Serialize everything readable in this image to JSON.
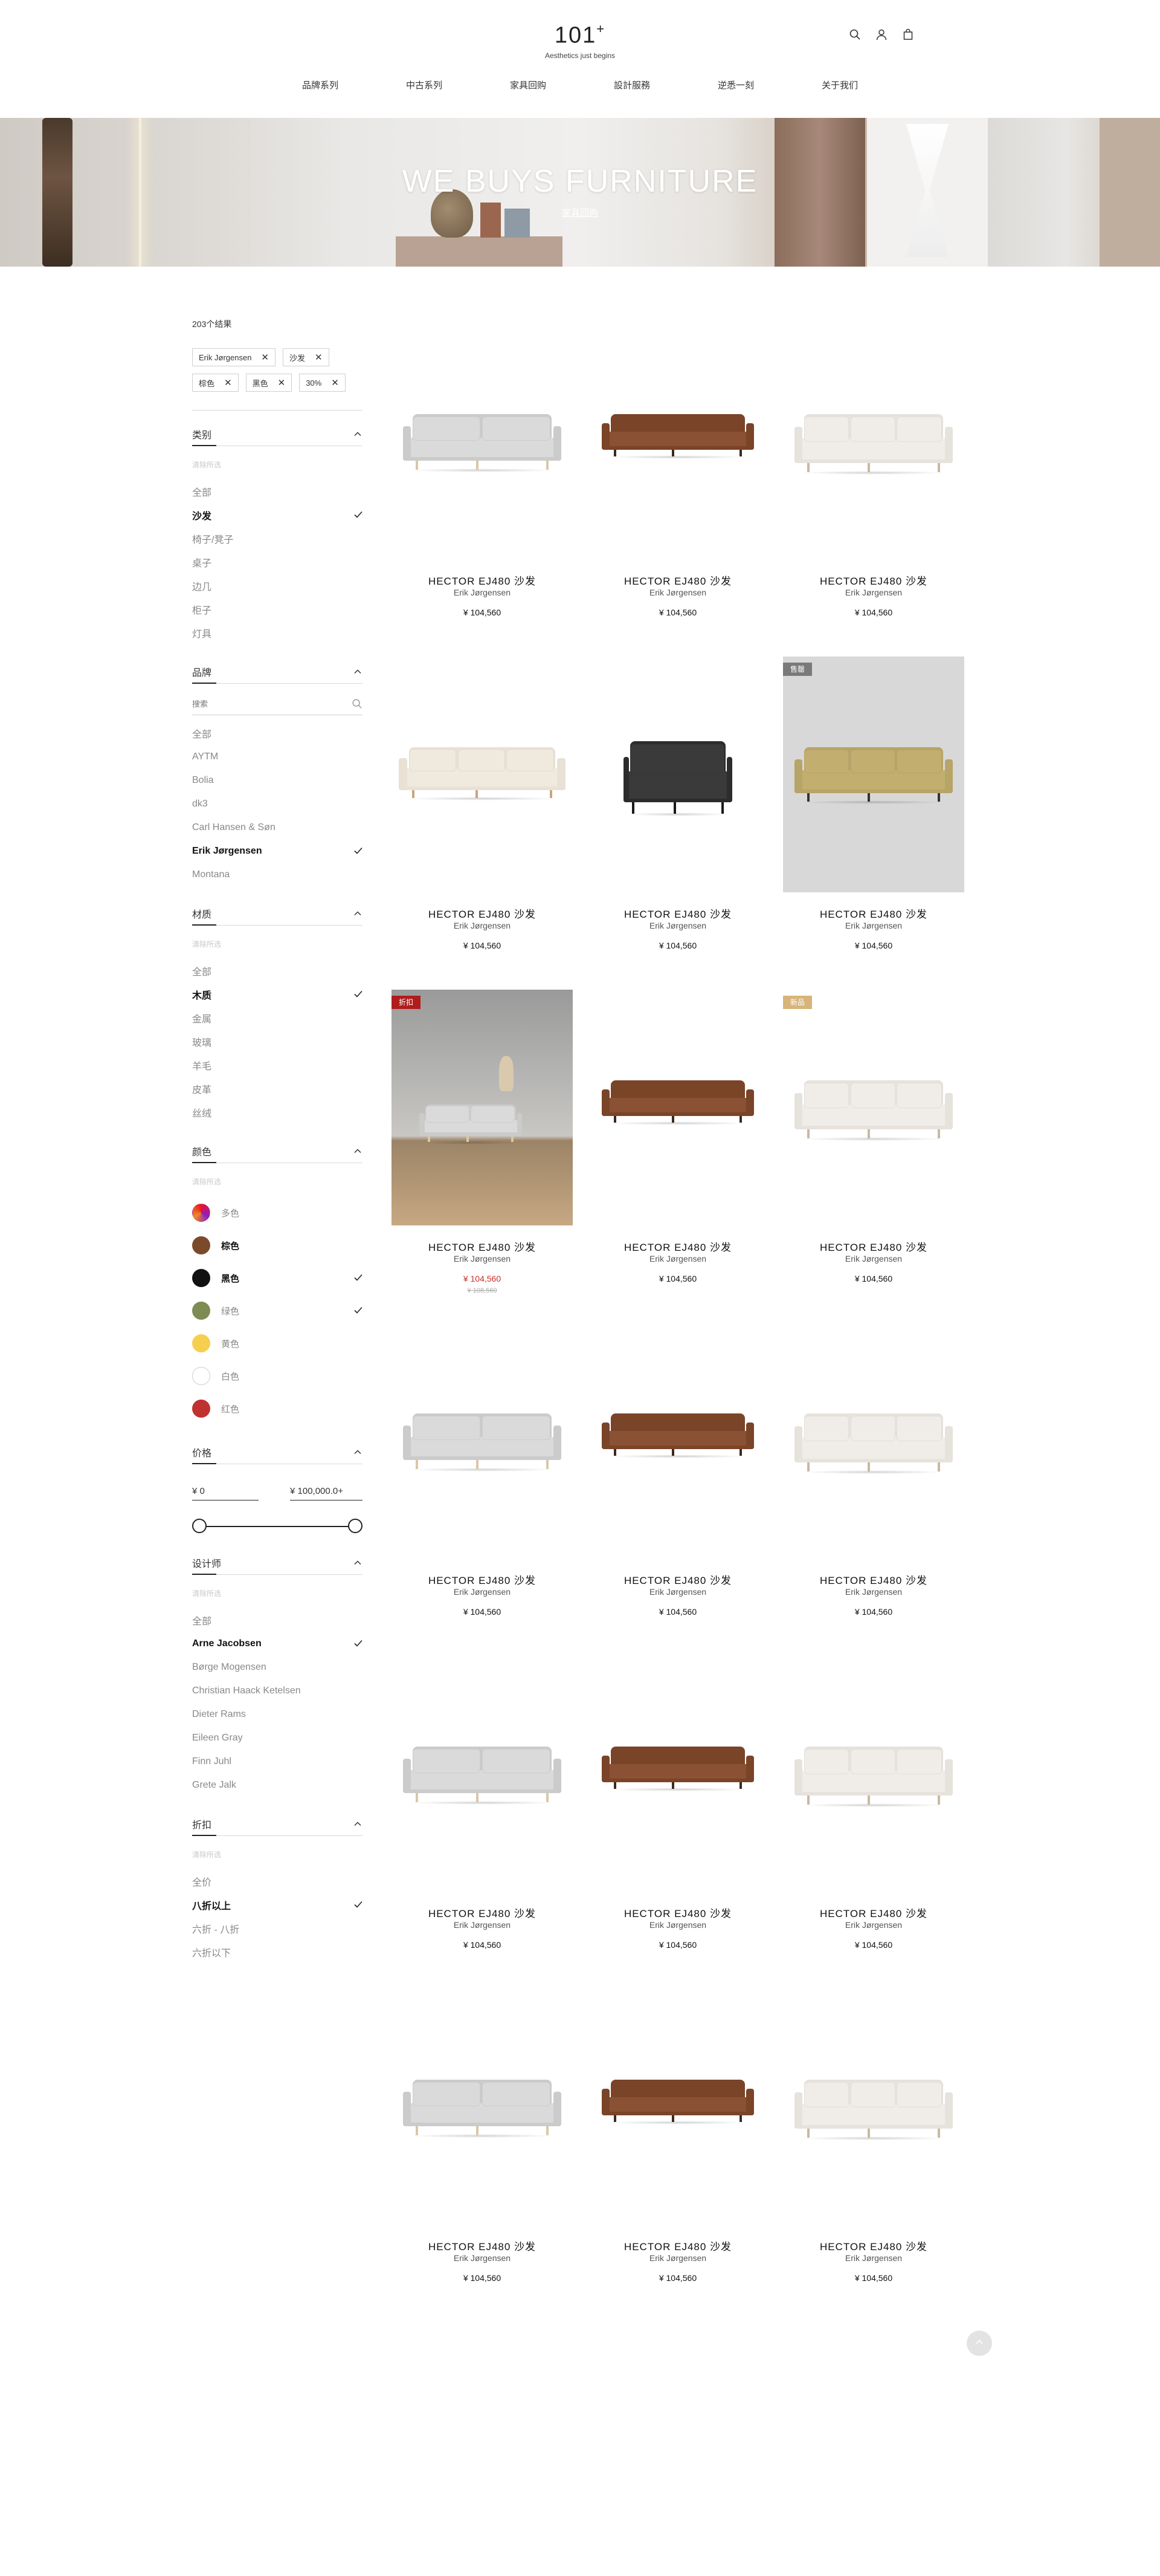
{
  "header": {
    "logo": "101",
    "logo_sup": "+",
    "tagline": "Aesthetics just begins",
    "icons": [
      "search-icon",
      "user-icon",
      "bag-icon"
    ]
  },
  "nav": [
    "品牌系列",
    "中古系列",
    "家具回购",
    "設計服務",
    "逆悉一刻",
    "关于我们"
  ],
  "hero": {
    "title": "WE BUYS FURNITURE",
    "link": "家具回购"
  },
  "sidebar": {
    "result_count": "203个结果",
    "chips": [
      "Erik Jørgensen",
      "沙发",
      "棕色",
      "黑色",
      "30%"
    ],
    "category": {
      "title": "类别",
      "clear": "清除所选",
      "options": [
        "全部",
        "沙发",
        "椅子/凳子",
        "桌子",
        "边几",
        "柜子",
        "灯具"
      ],
      "active": [
        1
      ]
    },
    "brand": {
      "title": "品牌",
      "search_placeholder": "搜索",
      "options": [
        "全部",
        "AYTM",
        "Bolia",
        "dk3",
        "Carl Hansen & Søn",
        "Erik Jørgensen",
        "Montana"
      ],
      "active": [
        5
      ]
    },
    "material": {
      "title": "材质",
      "clear": "清除所选",
      "options": [
        "全部",
        "木质",
        "金属",
        "玻璃",
        "羊毛",
        "皮革",
        "丝绒"
      ],
      "active": [
        1
      ]
    },
    "color": {
      "title": "颜色",
      "clear": "清除所选",
      "options": [
        {
          "label": "多色",
          "color": "multi"
        },
        {
          "label": "棕色",
          "color": "#7a4a2a"
        },
        {
          "label": "黑色",
          "color": "#111111"
        },
        {
          "label": "绿色",
          "color": "#7d8c52"
        },
        {
          "label": "黄色",
          "color": "#f5cf50"
        },
        {
          "label": "白色",
          "color": "#ffffff"
        },
        {
          "label": "红色",
          "color": "#c0322f"
        }
      ],
      "checked": [
        2,
        3
      ],
      "bold": [
        1,
        2
      ]
    },
    "price": {
      "title": "价格",
      "min": "¥ 0",
      "max": "¥ 100,000.0+"
    },
    "designer": {
      "title": "设计师",
      "clear": "清除所选",
      "options": [
        "全部",
        "Arne Jacobsen",
        "Børge Mogensen",
        "Christian Haack Ketelsen",
        "Dieter Rams",
        "Eileen Gray",
        "Finn Juhl",
        "Grete Jalk"
      ],
      "active": [
        1
      ]
    },
    "discount": {
      "title": "折扣",
      "clear": "清除所选",
      "options": [
        "全价",
        "八折以上",
        "六折 - 八折",
        "六折以下"
      ],
      "active": [
        1
      ]
    }
  },
  "products": [
    {
      "name": "HECTOR EJ480 沙发",
      "designer": "Erik Jørgensen",
      "price": "¥ 104,560",
      "style": "grey"
    },
    {
      "name": "HECTOR EJ480 沙发",
      "designer": "Erik Jørgensen",
      "price": "¥ 104,560",
      "style": "brown"
    },
    {
      "name": "HECTOR EJ480 沙发",
      "designer": "Erik Jørgensen",
      "price": "¥ 104,560",
      "style": "white"
    },
    {
      "name": "HECTOR EJ480 沙发",
      "designer": "Erik Jørgensen",
      "price": "¥ 104,560",
      "style": "cream"
    },
    {
      "name": "HECTOR EJ480 沙发",
      "designer": "Erik Jørgensen",
      "price": "¥ 104,560",
      "style": "black-chair"
    },
    {
      "name": "HECTOR EJ480 沙发",
      "designer": "Erik Jørgensen",
      "price": "¥ 104,560",
      "style": "olive",
      "badge": "售罄",
      "badge_color": "#7a7a7a"
    },
    {
      "name": "HECTOR EJ480 沙发",
      "designer": "Erik Jørgensen",
      "price": "¥ 104,560",
      "orig": "¥ 108,560",
      "style": "room",
      "badge": "折扣",
      "badge_color": "#b01c1c"
    },
    {
      "name": "HECTOR EJ480 沙发",
      "designer": "Erik Jørgensen",
      "price": "¥ 104,560",
      "style": "brown"
    },
    {
      "name": "HECTOR EJ480 沙发",
      "designer": "Erik Jørgensen",
      "price": "¥ 104,560",
      "style": "white",
      "badge": "新品",
      "badge_color": "#d8b47a"
    },
    {
      "name": "HECTOR EJ480 沙发",
      "designer": "Erik Jørgensen",
      "price": "¥ 104,560",
      "style": "grey"
    },
    {
      "name": "HECTOR EJ480 沙发",
      "designer": "Erik Jørgensen",
      "price": "¥ 104,560",
      "style": "brown"
    },
    {
      "name": "HECTOR EJ480 沙发",
      "designer": "Erik Jørgensen",
      "price": "¥ 104,560",
      "style": "white"
    },
    {
      "name": "HECTOR EJ480 沙发",
      "designer": "Erik Jørgensen",
      "price": "¥ 104,560",
      "style": "grey"
    },
    {
      "name": "HECTOR EJ480 沙发",
      "designer": "Erik Jørgensen",
      "price": "¥ 104,560",
      "style": "brown"
    },
    {
      "name": "HECTOR EJ480 沙发",
      "designer": "Erik Jørgensen",
      "price": "¥ 104,560",
      "style": "white"
    },
    {
      "name": "HECTOR EJ480 沙发",
      "designer": "Erik Jørgensen",
      "price": "¥ 104,560",
      "style": "grey"
    },
    {
      "name": "HECTOR EJ480 沙发",
      "designer": "Erik Jørgensen",
      "price": "¥ 104,560",
      "style": "brown"
    },
    {
      "name": "HECTOR EJ480 沙发",
      "designer": "Erik Jørgensen",
      "price": "¥ 104,560",
      "style": "white"
    }
  ],
  "colors": {
    "sale_price": "#c8302a",
    "check": "#222222"
  }
}
